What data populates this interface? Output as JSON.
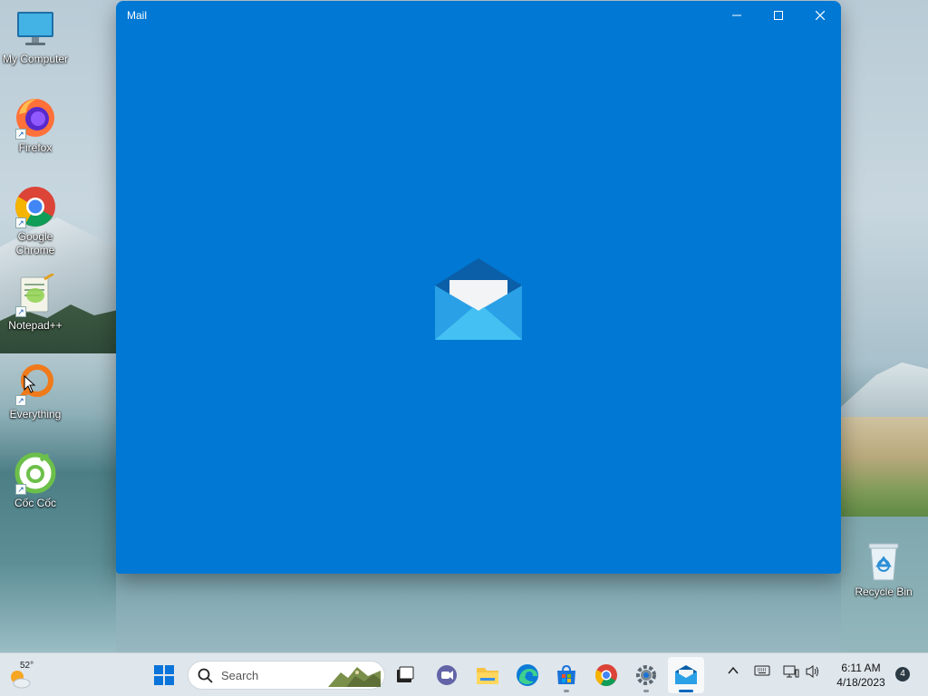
{
  "desktop": {
    "icons": [
      {
        "label": "My Computer"
      },
      {
        "label": "Firefox"
      },
      {
        "label": "Google Chrome"
      },
      {
        "label": "Notepad++"
      },
      {
        "label": "Everything"
      },
      {
        "label": "Cốc Cốc"
      }
    ],
    "recycle_bin": {
      "label": "Recycle Bin"
    }
  },
  "window": {
    "title": "Mail",
    "accent_color": "#0078d4",
    "controls": {
      "minimize": "minimize-icon",
      "maximize": "maximize-icon",
      "close": "close-icon"
    }
  },
  "taskbar": {
    "weather": {
      "temp": "52°"
    },
    "search": {
      "placeholder": "Search"
    },
    "apps": [
      "start",
      "search",
      "task-view",
      "teams-chat",
      "file-explorer",
      "edge",
      "microsoft-store",
      "chrome",
      "settings",
      "mail"
    ],
    "active_app": "mail",
    "tray": {
      "chevron": "chevron-up-icon",
      "keyboard": "keyboard-icon",
      "network": "network-icon",
      "volume": "volume-icon"
    },
    "clock": {
      "time": "6:11 AM",
      "date": "4/18/2023"
    },
    "notification_count": "4"
  }
}
